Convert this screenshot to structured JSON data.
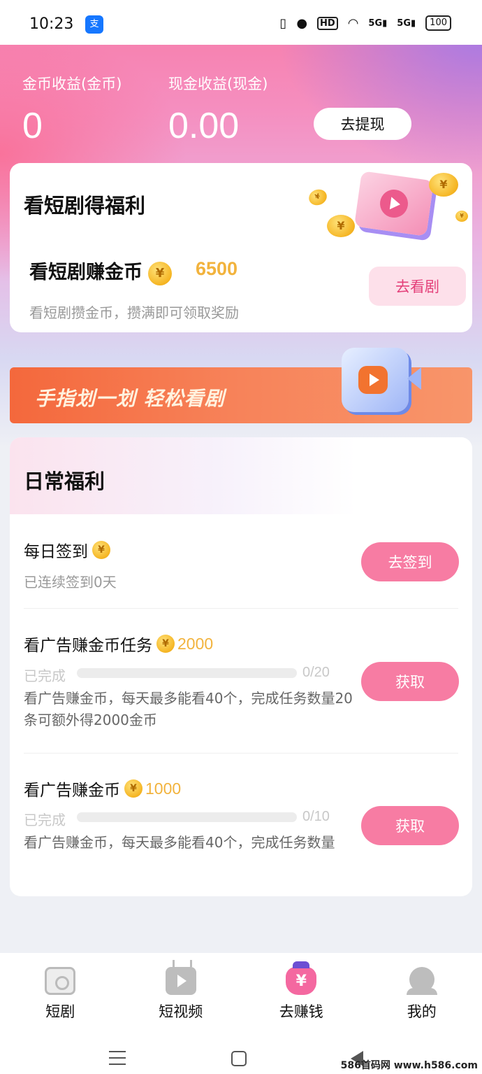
{
  "status_bar": {
    "time": "10:23",
    "app_badge": "支",
    "battery": "100",
    "network_a": "5G",
    "network_b": "5G",
    "hd": "HD"
  },
  "earnings": {
    "coin_label": "金币收益(金币)",
    "coin_value": "0",
    "cash_label": "现金收益(现金)",
    "cash_value": "0.00",
    "withdraw_label": "去提现"
  },
  "drama_card": {
    "title": "看短剧得福利",
    "subtitle": "看短剧赚金币",
    "coin_amount": "6500",
    "description": "看短剧攒金币，攒满即可领取奖励",
    "button_label": "去看剧"
  },
  "banner": {
    "text": "手指划一划 轻松看剧"
  },
  "daily": {
    "title": "日常福利",
    "tasks": [
      {
        "name": "每日签到",
        "note": "已连续签到0天",
        "button": "去签到"
      },
      {
        "name": "看广告赚金币任务",
        "reward": "2000",
        "progress_label": "已完成",
        "count": "0/20",
        "progress_fraction": 0,
        "description": "看广告赚金币，每天最多能看40个，完成任务数量20条可额外得2000金币",
        "button": "获取"
      },
      {
        "name": "看广告赚金币",
        "reward": "1000",
        "progress_label": "已完成",
        "count": "0/10",
        "progress_fraction": 0,
        "description": "看广告赚金币，每天最多能看40个，完成任务数量",
        "button": "获取"
      }
    ]
  },
  "tabbar": {
    "items": [
      {
        "label": "短剧",
        "icon": "drama-icon"
      },
      {
        "label": "短视频",
        "icon": "video-icon"
      },
      {
        "label": "去赚钱",
        "icon": "money-bag-icon",
        "active": true
      },
      {
        "label": "我的",
        "icon": "profile-icon"
      }
    ]
  },
  "coin_symbol": "¥",
  "watermark": "586首码网 www.h586.com",
  "colors": {
    "accent_pink": "#f77ca3",
    "coin_gold": "#f2b33d",
    "banner_orange": "#f4683c"
  }
}
